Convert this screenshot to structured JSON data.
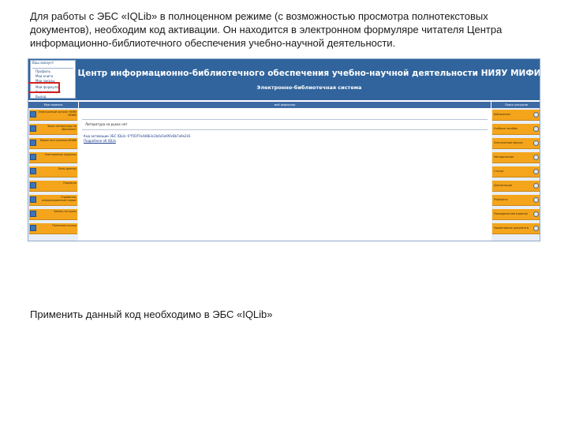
{
  "intro_text": "Для работы с ЭБС «IQLib» в полноценном режиме (с возможностью просмотра полнотекстовых документов), необходим код активации. Он находится в электронном формуляре читателя Центра информационно-библиотечного обеспечения учебно-научной деятельности.",
  "outro_text": "Применить данный код необходимо в ЭБС «IQLib»",
  "screenshot": {
    "header_title": "Центр информационно-библиотечного обеспечения учебно-научной деятельности НИЯУ МИФИ",
    "header_subtitle": "Электронно-библиотечная система",
    "account_panel": {
      "title": "Ваш аккаунт",
      "items": [
        "Профиль",
        "Мои книги",
        "Мои заказы",
        "Мой формуляр",
        "Код активации",
        "Выход"
      ]
    },
    "left_column": {
      "header": "Мои сервисы",
      "buttons": [
        "Электронный каталог НИЯУ МИФИ",
        "Заказ литературы на абонемент",
        "Новые поступления МИФИ",
        "Электронные журналы",
        "Базы данных",
        "Подписка",
        "Справочно-информационный сервис",
        "Запись на курсы",
        "Полезные ссылки"
      ]
    },
    "center": {
      "tab": "мой формуляр",
      "box_title": "Литература на руках нет",
      "code_line": "Код активации ЭБС IQLib: 6\"f5f2f7e4d8b3c2b4a5e6f0c8b7a9e2d1",
      "code_link": "Подробнее об IQLib"
    },
    "right_column": {
      "header": "Поиск ресурсов",
      "buttons": [
        "Библиотеки",
        "Учебные пособия",
        "Электронные версии",
        "Методические",
        "Статьи",
        "Диссертации",
        "Рефераты",
        "Периодические издания",
        "Нормативные документы"
      ]
    }
  }
}
